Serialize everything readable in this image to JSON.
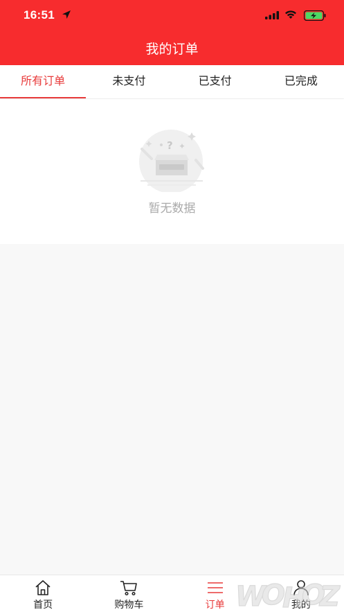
{
  "status_bar": {
    "time": "16:51"
  },
  "header": {
    "title": "我的订单"
  },
  "tabs": [
    {
      "label": "所有订单",
      "active": true
    },
    {
      "label": "未支付",
      "active": false
    },
    {
      "label": "已支付",
      "active": false
    },
    {
      "label": "已完成",
      "active": false
    }
  ],
  "empty_state": {
    "text": "暂无数据"
  },
  "bottom_nav": [
    {
      "label": "首页",
      "icon": "home-icon",
      "active": false
    },
    {
      "label": "购物车",
      "icon": "cart-icon",
      "active": false
    },
    {
      "label": "订单",
      "icon": "menu-list-icon",
      "active": true
    },
    {
      "label": "我的",
      "icon": "user-icon",
      "active": false
    }
  ],
  "colors": {
    "brand": "#f72c2e",
    "active": "#e83a3a",
    "empty_text": "#aaaaaa"
  }
}
